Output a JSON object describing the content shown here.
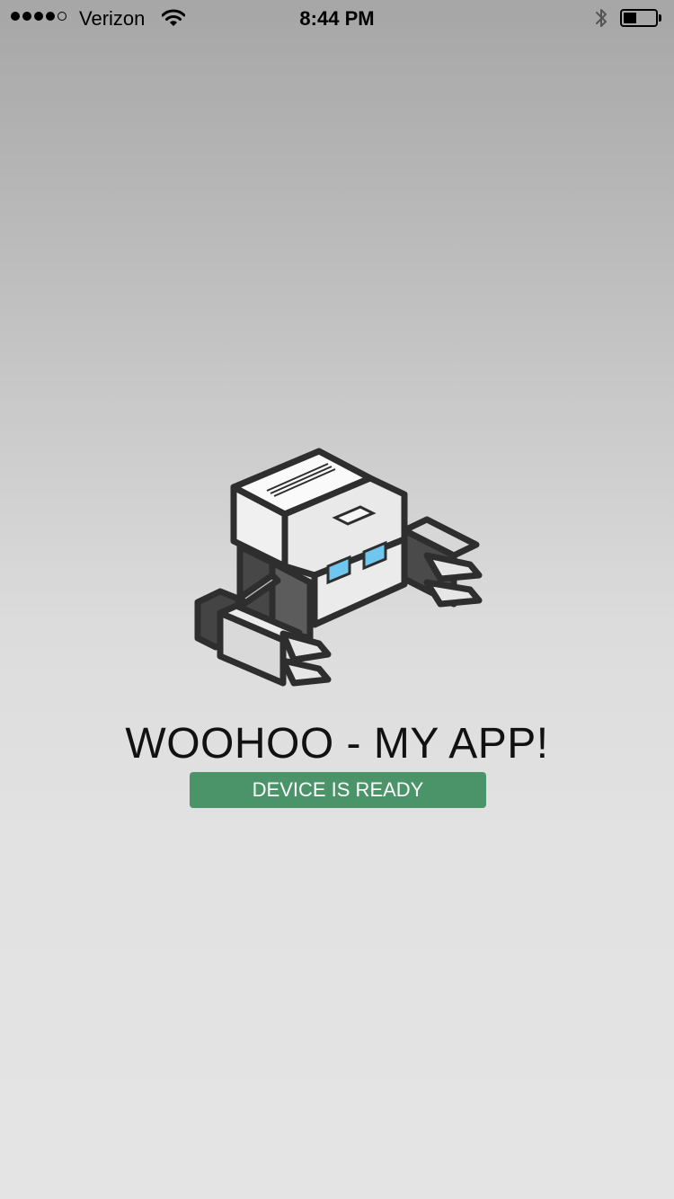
{
  "status_bar": {
    "signal_bars_filled": 4,
    "signal_bars_total": 5,
    "carrier": "Verizon",
    "time": "8:44 PM",
    "battery_level_fraction": 0.4
  },
  "app": {
    "title": "WOOHOO - MY APP!",
    "status_label": "DEVICE IS READY"
  },
  "colors": {
    "status_ready": "#4b946a",
    "title_text": "#111111",
    "background_top": "#a6a6a6",
    "background_bottom": "#e4e4e4"
  },
  "icons": [
    "signal-dots-icon",
    "wifi-icon",
    "bluetooth-icon",
    "battery-icon",
    "robot-logo"
  ]
}
